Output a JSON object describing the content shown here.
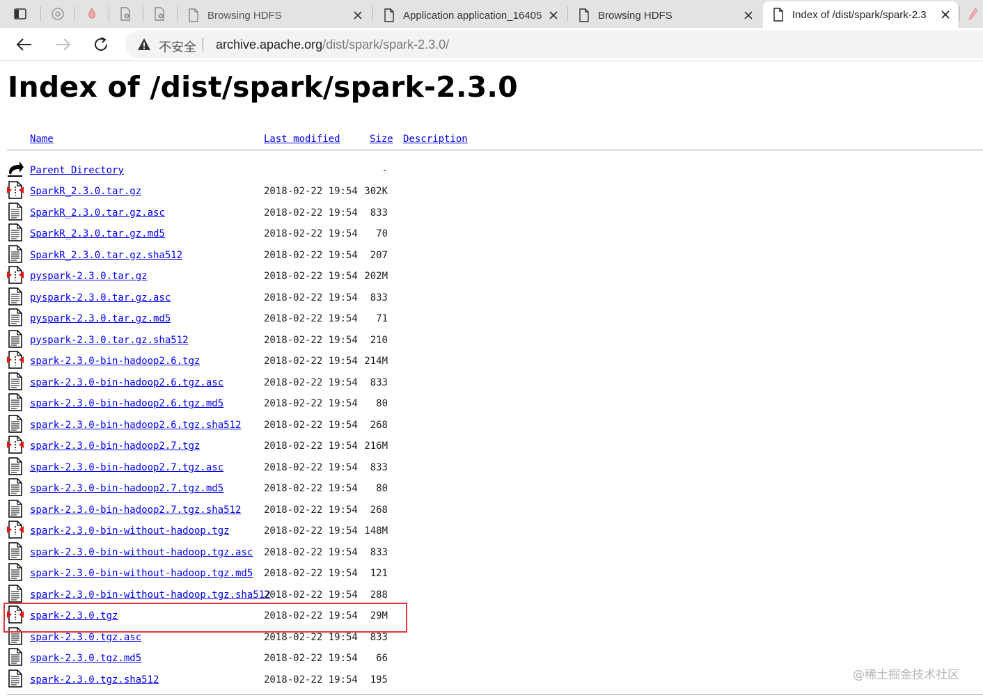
{
  "browser": {
    "tabs": [
      {
        "title": "Browsing HDFS",
        "active": false
      },
      {
        "title": "Application application_16405",
        "active": false
      },
      {
        "title": "Browsing HDFS",
        "active": false
      },
      {
        "title": "Index of /dist/spark/spark-2.3",
        "active": true
      }
    ],
    "security_label": "不安全",
    "url_host": "archive.apache.org",
    "url_path": "/dist/spark/spark-2.3.0/"
  },
  "page": {
    "title": "Index of /dist/spark/spark-2.3.0",
    "columns": {
      "name": "Name",
      "last_modified": "Last modified",
      "size": "Size",
      "description": "Description"
    },
    "parent": {
      "name": "Parent Directory",
      "size": "-"
    },
    "files": [
      {
        "name": "SparkR_2.3.0.tar.gz",
        "date": "2018-02-22 19:54",
        "size": "302K",
        "icon": "archive-icon"
      },
      {
        "name": "SparkR_2.3.0.tar.gz.asc",
        "date": "2018-02-22 19:54",
        "size": "833",
        "icon": "text-file-icon"
      },
      {
        "name": "SparkR_2.3.0.tar.gz.md5",
        "date": "2018-02-22 19:54",
        "size": "70",
        "icon": "text-file-icon"
      },
      {
        "name": "SparkR_2.3.0.tar.gz.sha512",
        "date": "2018-02-22 19:54",
        "size": "207",
        "icon": "text-file-icon"
      },
      {
        "name": "pyspark-2.3.0.tar.gz",
        "date": "2018-02-22 19:54",
        "size": "202M",
        "icon": "archive-icon"
      },
      {
        "name": "pyspark-2.3.0.tar.gz.asc",
        "date": "2018-02-22 19:54",
        "size": "833",
        "icon": "text-file-icon"
      },
      {
        "name": "pyspark-2.3.0.tar.gz.md5",
        "date": "2018-02-22 19:54",
        "size": "71",
        "icon": "text-file-icon"
      },
      {
        "name": "pyspark-2.3.0.tar.gz.sha512",
        "date": "2018-02-22 19:54",
        "size": "210",
        "icon": "text-file-icon"
      },
      {
        "name": "spark-2.3.0-bin-hadoop2.6.tgz",
        "date": "2018-02-22 19:54",
        "size": "214M",
        "icon": "archive-icon"
      },
      {
        "name": "spark-2.3.0-bin-hadoop2.6.tgz.asc",
        "date": "2018-02-22 19:54",
        "size": "833",
        "icon": "text-file-icon"
      },
      {
        "name": "spark-2.3.0-bin-hadoop2.6.tgz.md5",
        "date": "2018-02-22 19:54",
        "size": "80",
        "icon": "text-file-icon"
      },
      {
        "name": "spark-2.3.0-bin-hadoop2.6.tgz.sha512",
        "date": "2018-02-22 19:54",
        "size": "268",
        "icon": "text-file-icon"
      },
      {
        "name": "spark-2.3.0-bin-hadoop2.7.tgz",
        "date": "2018-02-22 19:54",
        "size": "216M",
        "icon": "archive-icon"
      },
      {
        "name": "spark-2.3.0-bin-hadoop2.7.tgz.asc",
        "date": "2018-02-22 19:54",
        "size": "833",
        "icon": "text-file-icon"
      },
      {
        "name": "spark-2.3.0-bin-hadoop2.7.tgz.md5",
        "date": "2018-02-22 19:54",
        "size": "80",
        "icon": "text-file-icon"
      },
      {
        "name": "spark-2.3.0-bin-hadoop2.7.tgz.sha512",
        "date": "2018-02-22 19:54",
        "size": "268",
        "icon": "text-file-icon"
      },
      {
        "name": "spark-2.3.0-bin-without-hadoop.tgz",
        "date": "2018-02-22 19:54",
        "size": "148M",
        "icon": "archive-icon"
      },
      {
        "name": "spark-2.3.0-bin-without-hadoop.tgz.asc",
        "date": "2018-02-22 19:54",
        "size": "833",
        "icon": "text-file-icon"
      },
      {
        "name": "spark-2.3.0-bin-without-hadoop.tgz.md5",
        "date": "2018-02-22 19:54",
        "size": "121",
        "icon": "text-file-icon"
      },
      {
        "name": "spark-2.3.0-bin-without-hadoop.tgz.sha512",
        "date": "2018-02-22 19:54",
        "size": "288",
        "icon": "text-file-icon"
      },
      {
        "name": "spark-2.3.0.tgz",
        "date": "2018-02-22 19:54",
        "size": "29M",
        "icon": "archive-icon",
        "highlighted": true
      },
      {
        "name": "spark-2.3.0.tgz.asc",
        "date": "2018-02-22 19:54",
        "size": "833",
        "icon": "text-file-icon"
      },
      {
        "name": "spark-2.3.0.tgz.md5",
        "date": "2018-02-22 19:54",
        "size": "66",
        "icon": "text-file-icon"
      },
      {
        "name": "spark-2.3.0.tgz.sha512",
        "date": "2018-02-22 19:54",
        "size": "195",
        "icon": "text-file-icon"
      }
    ]
  },
  "watermark": "@稀土掘金技术社区",
  "colors": {
    "link": "#0000ee",
    "highlight": "#e0353a",
    "tabstrip": "#e3e3e3"
  }
}
